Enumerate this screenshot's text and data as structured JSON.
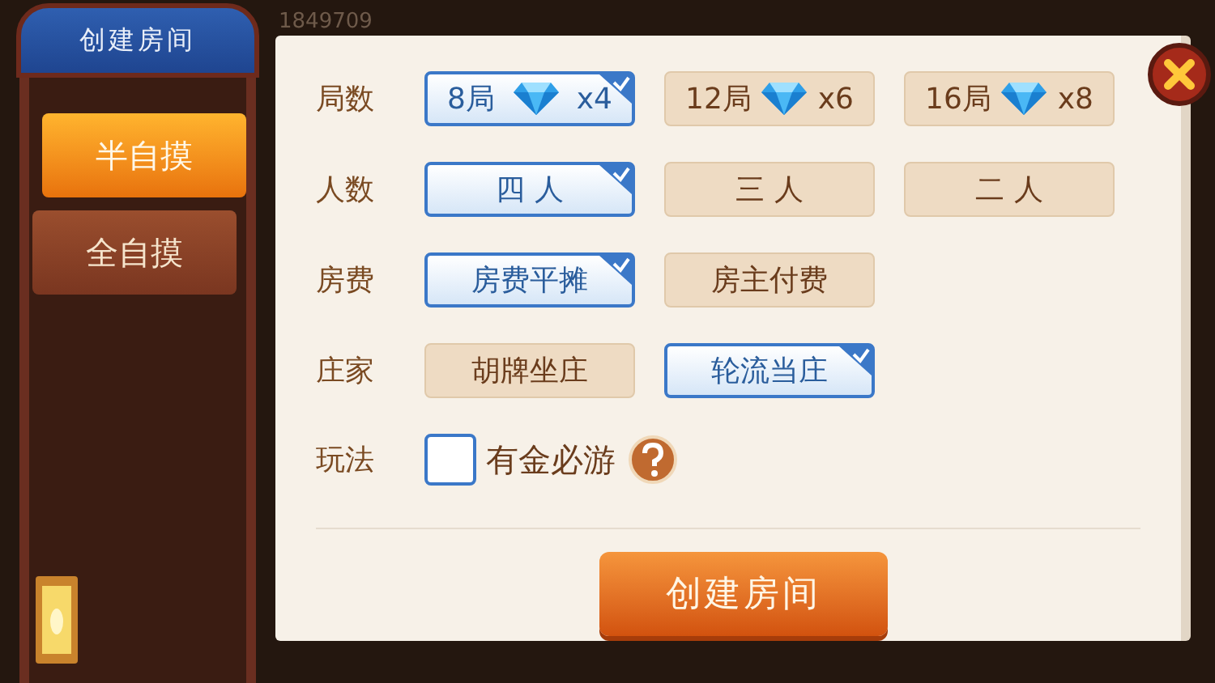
{
  "header": {
    "title": "创建房间"
  },
  "background_id": "1849709",
  "modes": [
    {
      "label": "半自摸",
      "selected": true
    },
    {
      "label": "全自摸",
      "selected": false
    }
  ],
  "rows": [
    {
      "label": "局数",
      "kind": "options",
      "options": [
        {
          "label": "8局",
          "cost": "x4",
          "selected": true
        },
        {
          "label": "12局",
          "cost": "x6",
          "selected": false
        },
        {
          "label": "16局",
          "cost": "x8",
          "selected": false
        }
      ]
    },
    {
      "label": "人数",
      "kind": "options",
      "options": [
        {
          "label": "四 人",
          "selected": true
        },
        {
          "label": "三 人",
          "selected": false
        },
        {
          "label": "二 人",
          "selected": false
        }
      ]
    },
    {
      "label": "房费",
      "kind": "options",
      "options": [
        {
          "label": "房费平摊",
          "selected": true
        },
        {
          "label": "房主付费",
          "selected": false
        }
      ]
    },
    {
      "label": "庄家",
      "kind": "options",
      "options": [
        {
          "label": "胡牌坐庄",
          "selected": false
        },
        {
          "label": "轮流当庄",
          "selected": true
        }
      ]
    },
    {
      "label": "玩法",
      "kind": "checkbox",
      "option": {
        "label": "有金必游",
        "checked": false
      }
    }
  ],
  "create_button": "创建房间"
}
